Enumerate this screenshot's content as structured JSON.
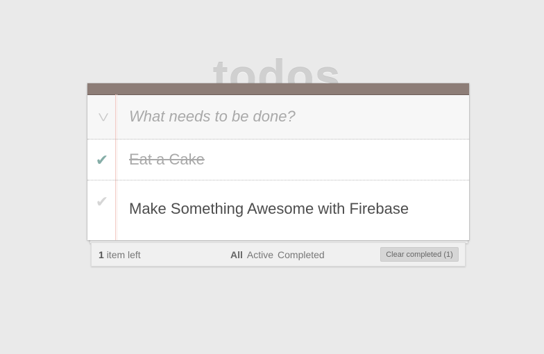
{
  "header": {
    "title": "todos"
  },
  "new_todo": {
    "placeholder": "What needs to be done?",
    "value": "",
    "toggle_all_icon": "chevron-double-down-icon"
  },
  "todos": [
    {
      "label": "Eat a Cake",
      "completed": true,
      "check_icon": "checkmark-icon"
    },
    {
      "label": "Make Something Awesome with Firebase",
      "completed": false,
      "check_icon": "checkmark-icon"
    }
  ],
  "footer": {
    "count": "1",
    "count_suffix": "item left",
    "filters": [
      "All",
      "Active",
      "Completed"
    ],
    "selected_filter": "All",
    "clear_label": "Clear completed (1)"
  },
  "colors": {
    "background": "#eaeaea",
    "title": "#d0d0d0",
    "topbar": "#8d7d77",
    "check_done": "#85ada7",
    "check_undone": "#d6d6d6"
  }
}
